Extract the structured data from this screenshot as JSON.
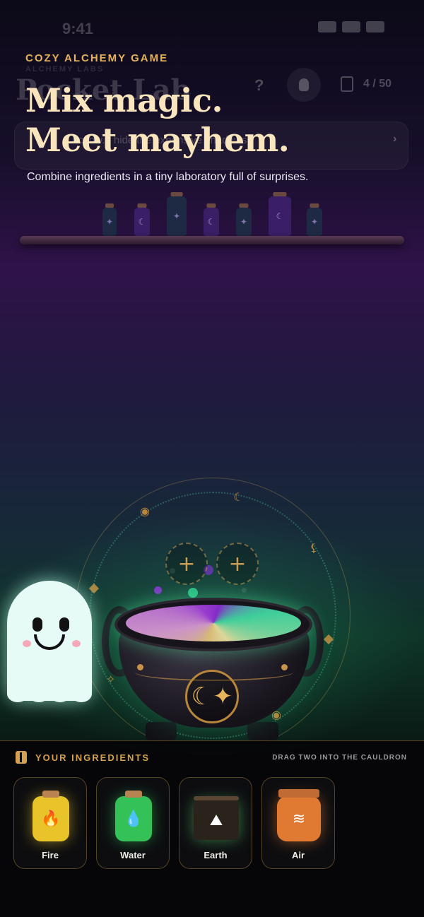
{
  "background_ui": {
    "status_time": "9:41",
    "subtitle": "ALCHEMY LABS",
    "title": "Pocket Lab",
    "help_glyph": "?",
    "discovered_count": "4 / 50",
    "hint_text": "...hollow... hide the expensive shadows"
  },
  "overlay": {
    "tagline": "COZY ALCHEMY GAME",
    "headline_line1": "Mix magic.",
    "headline_line2": "Meet mayhem.",
    "subheadline": "Combine ingredients in a tiny laboratory full of surprises."
  },
  "slots": {
    "slot_1_glyph": "+",
    "slot_2_glyph": "+"
  },
  "cauldron": {
    "emblem_glyph": "☾✦"
  },
  "ingredients_panel": {
    "title": "YOUR INGREDIENTS",
    "hint": "DRAG TWO INTO THE CAULDRON",
    "items": [
      {
        "label": "Fire",
        "icon": "flame-icon",
        "color": "#e8c42a"
      },
      {
        "label": "Water",
        "icon": "droplet-icon",
        "color": "#34c157"
      },
      {
        "label": "Earth",
        "icon": "mountain-icon",
        "color": "#64dc78"
      },
      {
        "label": "Air",
        "icon": "wind-icon",
        "color": "#e07a32"
      }
    ]
  },
  "colors": {
    "accent_gold": "#d4a04e",
    "headline_cream": "#f8e4bd",
    "ghost": "#e6fbf6"
  }
}
